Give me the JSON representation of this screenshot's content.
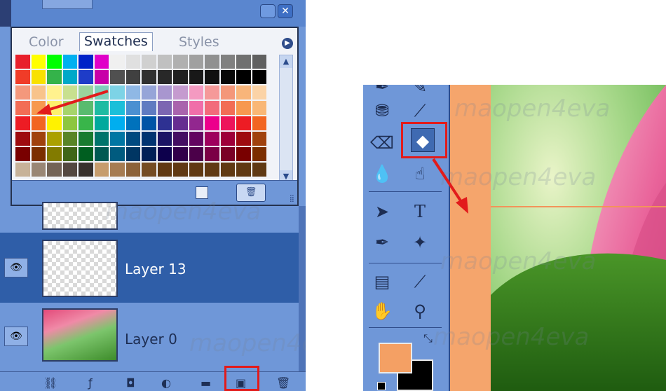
{
  "swatches_panel": {
    "tabs": [
      "Color",
      "Swatches",
      "Styles"
    ],
    "active_tab": "Swatches",
    "colors": [
      [
        "#e8202c",
        "#ffff00",
        "#00ff00",
        "#00b0f0",
        "#0022c8",
        "#e000c8",
        "#f0f0f0",
        "#e0e0e0",
        "#d0d0d0",
        "#c0c0c0",
        "#b0b0b0",
        "#a0a0a0",
        "#909090",
        "#808080",
        "#707070",
        "#606060"
      ],
      [
        "#f03c28",
        "#f8e100",
        "#34b34a",
        "#00a8c8",
        "#1e3cc8",
        "#c800a8",
        "#505050",
        "#404040",
        "#303030",
        "#282828",
        "#202020",
        "#181818",
        "#101010",
        "#080808",
        "#000000",
        "#000000"
      ],
      [
        "#f4987c",
        "#f8c38b",
        "#fff28e",
        "#c8e08f",
        "#9bd39c",
        "#7fd1bc",
        "#7dd3e6",
        "#8fb8e5",
        "#96a5d8",
        "#a896cf",
        "#c59bcf",
        "#f49ac1",
        "#f59999",
        "#f49779",
        "#f8b57a",
        "#fbd3a6"
      ],
      [
        "#f26d55",
        "#f7984f",
        "#fdf06d",
        "#a6d46b",
        "#58bb6f",
        "#1ebba2",
        "#1bbfd9",
        "#4b90d1",
        "#5f7bc1",
        "#7c66b2",
        "#a964ad",
        "#f06ea9",
        "#f26b7b",
        "#f26d55",
        "#f7984f",
        "#f9b776"
      ],
      [
        "#ed1c24",
        "#f26522",
        "#fff200",
        "#8dc63f",
        "#39b54a",
        "#00a99d",
        "#00aeef",
        "#0072bc",
        "#0054a6",
        "#2e3192",
        "#662d91",
        "#92278f",
        "#ec008c",
        "#ed145b",
        "#ed1c24",
        "#f26522"
      ],
      [
        "#9e0b0f",
        "#a0410d",
        "#aba000",
        "#598527",
        "#197b30",
        "#00746b",
        "#0076a3",
        "#004a80",
        "#003471",
        "#1b1464",
        "#440e62",
        "#630460",
        "#9e005d",
        "#9e0039",
        "#9e0b0f",
        "#a0410d"
      ],
      [
        "#790000",
        "#7b2e00",
        "#827b00",
        "#406618",
        "#005e20",
        "#005952",
        "#005b7f",
        "#003663",
        "#002157",
        "#0d004c",
        "#32004b",
        "#4b0049",
        "#7b0046",
        "#7a0026",
        "#790000",
        "#7b2e00"
      ],
      [
        "#c7b299",
        "#998675",
        "#736357",
        "#534741",
        "#37302d",
        "#c69c6d",
        "#a67c52",
        "#8c6239",
        "#754c24",
        "#603913",
        "#603913",
        "#603913",
        "#603913",
        "#603913",
        "#603913",
        "#603913"
      ]
    ]
  },
  "layers": [
    {
      "name": "",
      "visible": false,
      "selected": false
    },
    {
      "name": "Layer 13",
      "visible": true,
      "selected": true
    },
    {
      "name": "Layer 0",
      "visible": true,
      "selected": false
    }
  ],
  "layers_toolbar": [
    "link-icon",
    "layer-style-icon",
    "mask-icon",
    "adjustment-icon",
    "folder-icon",
    "new-layer-icon",
    "trash-icon"
  ],
  "toolbox": {
    "tools": [
      "stamp-icon",
      "brush-icon",
      "eraser-icon",
      "paint-bucket-icon",
      "blur-icon",
      "smudge-icon",
      "path-selection-icon",
      "type-icon",
      "pen-icon",
      "custom-shape-icon",
      "notes-icon",
      "eyedropper-icon",
      "hand-icon",
      "zoom-icon"
    ],
    "active_tool": "paint-bucket-icon",
    "foreground_color": "#f4a064",
    "background_color": "#000000"
  },
  "canvas": {
    "bg_color": "#f5a56c",
    "guide_color": "#f3935a"
  },
  "watermark": "maopen4eva",
  "annotation_color": "#e21b1b"
}
